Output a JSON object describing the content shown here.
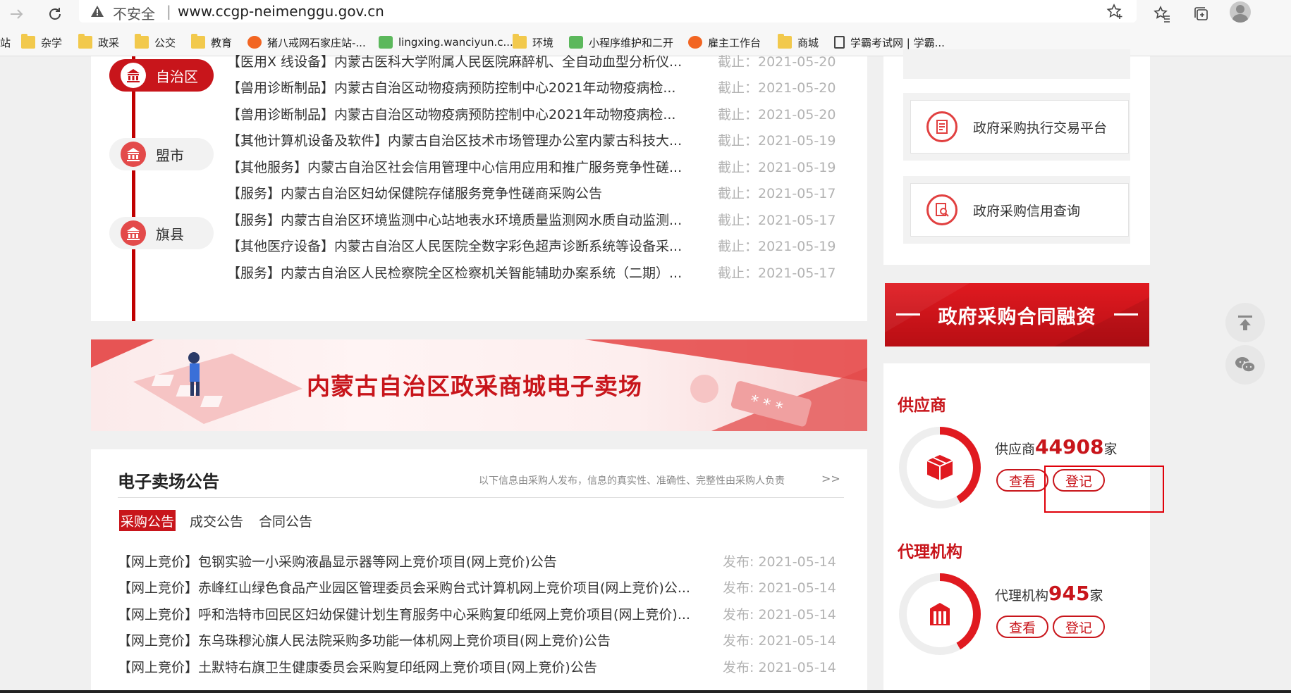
{
  "browser": {
    "security_label": "不安全",
    "separator": "|",
    "url": "www.ccgp-neimenggu.gov.cn"
  },
  "bookmarks": [
    {
      "label": "站",
      "icon": "none"
    },
    {
      "label": "杂学",
      "icon": "folder-icon"
    },
    {
      "label": "政采",
      "icon": "folder-icon"
    },
    {
      "label": "公交",
      "icon": "folder-icon"
    },
    {
      "label": "教育",
      "icon": "folder-icon"
    },
    {
      "label": "猪八戒网石家庄站-...",
      "icon": "site-icon"
    },
    {
      "label": "lingxing.wanciyun.c...",
      "icon": "site-icon"
    },
    {
      "label": "环境",
      "icon": "folder-icon"
    },
    {
      "label": "小程序维护和二开",
      "icon": "site-icon"
    },
    {
      "label": "雇主工作台",
      "icon": "site-icon"
    },
    {
      "label": "商城",
      "icon": "folder-icon"
    },
    {
      "label": "学霸考试网 | 学霸...",
      "icon": "document-icon"
    }
  ],
  "timeline": {
    "items": [
      "自治区",
      "盟市",
      "旗县"
    ],
    "active_index": 0
  },
  "top_notices": [
    {
      "title": "【医用X 线设备】内蒙古医科大学附属人民医院麻醉机、全自动血型分析仪...",
      "date": "截止：2021-05-20"
    },
    {
      "title": "【兽用诊断制品】内蒙古自治区动物疫病预防控制中心2021年动物疫病检...",
      "date": "截止：2021-05-20"
    },
    {
      "title": "【兽用诊断制品】内蒙古自治区动物疫病预防控制中心2021年动物疫病检...",
      "date": "截止：2021-05-20"
    },
    {
      "title": "【其他计算机设备及软件】内蒙古自治区技术市场管理办公室内蒙古科技大...",
      "date": "截止：2021-05-19"
    },
    {
      "title": "【其他服务】内蒙古自治区社会信用管理中心信用应用和推广服务竞争性磋...",
      "date": "截止：2021-05-19"
    },
    {
      "title": "【服务】内蒙古自治区妇幼保健院存储服务竞争性磋商采购公告",
      "date": "截止：2021-05-17"
    },
    {
      "title": "【服务】内蒙古自治区环境监测中心站地表水环境质量监测网水质自动监测...",
      "date": "截止：2021-05-17"
    },
    {
      "title": "【其他医疗设备】内蒙古自治区人民医院全数字彩色超声诊断系统等设备采...",
      "date": "截止：2021-05-19"
    },
    {
      "title": "【服务】内蒙古自治区人民检察院全区检察机关智能辅助办案系统（二期）...",
      "date": "截止：2021-05-17"
    }
  ],
  "banner": {
    "title": "内蒙古自治区政采商城电子卖场"
  },
  "emall": {
    "heading": "电子卖场公告",
    "disclaimer": "以下信息由采购人发布，信息的真实性、准确性、完整性由采购人负责",
    "more": ">>",
    "tabs": [
      "采购公告",
      "成交公告",
      "合同公告"
    ],
    "active_tab": 0,
    "rows": [
      {
        "title": "【网上竞价】包钢实验一小采购液晶显示器等网上竞价项目(网上竞价)公告",
        "date": "发布: 2021-05-14"
      },
      {
        "title": "【网上竞价】赤峰红山绿色食品产业园区管理委员会采购台式计算机网上竞价项目(网上竞价)公...",
        "date": "发布: 2021-05-14"
      },
      {
        "title": "【网上竞价】呼和浩特市回民区妇幼保健计划生育服务中心采购复印纸网上竞价项目(网上竞价)...",
        "date": "发布: 2021-05-14"
      },
      {
        "title": "【网上竞价】东乌珠穆沁旗人民法院采购多功能一体机网上竞价项目(网上竞价)公告",
        "date": "发布: 2021-05-14"
      },
      {
        "title": "【网上竞价】土默特右旗卫生健康委员会采购复印纸网上竞价项目(网上竞价)公告",
        "date": "发布: 2021-05-14"
      }
    ]
  },
  "services": [
    {
      "label": "政府采购执行交易平台",
      "icon": "platform-icon"
    },
    {
      "label": "政府采购信用查询",
      "icon": "credit-search-icon"
    }
  ],
  "finance": {
    "title": "政府采购合同融资"
  },
  "suppliers": {
    "heading": "供应商",
    "prefix": "供应商",
    "count": "44908",
    "suffix": "家",
    "view_label": "查看",
    "register_label": "登记"
  },
  "agencies": {
    "heading": "代理机构",
    "prefix": "代理机构",
    "count": "945",
    "suffix": "家",
    "view_label": "查看",
    "register_label": "登记"
  },
  "colors": {
    "accent": "#c8151b",
    "annotation": "#e0000a"
  }
}
